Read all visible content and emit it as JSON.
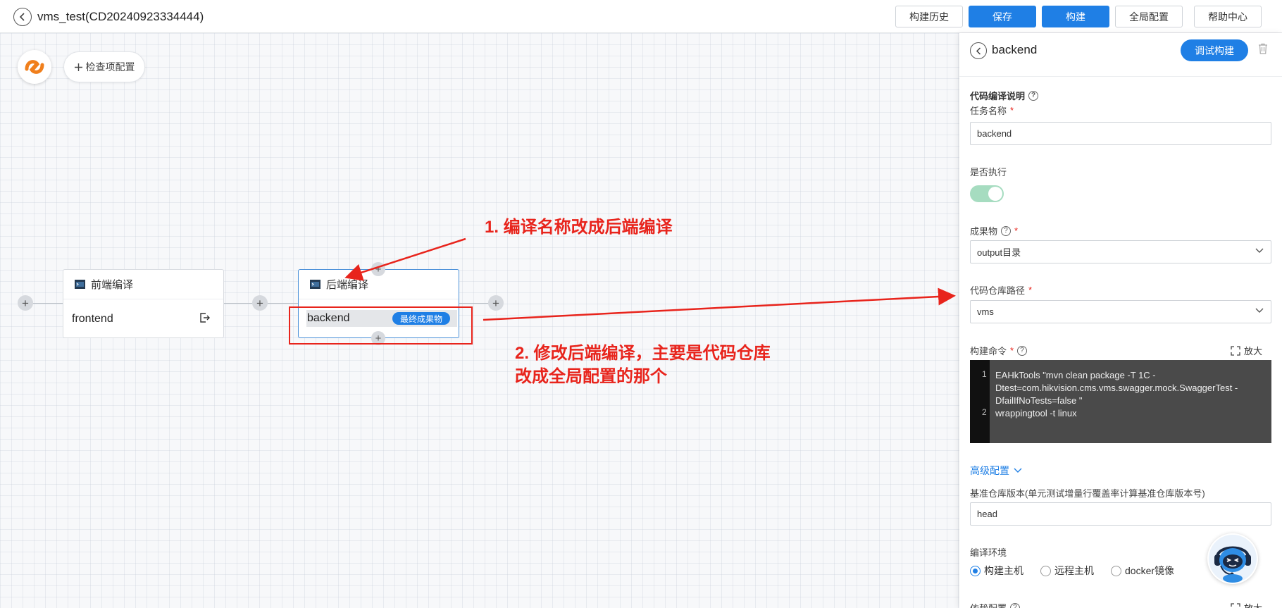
{
  "header": {
    "title": "vms_test(CD20240923334444)",
    "buttons": {
      "history": "构建历史",
      "save": "保存",
      "build": "构建",
      "global_config": "全局配置",
      "help": "帮助中心"
    }
  },
  "canvas": {
    "check_config_label": "检查项配置",
    "plus_symbol": "+",
    "nodes": [
      {
        "title": "前端编译",
        "job": "frontend"
      },
      {
        "title": "后端编译",
        "job": "backend",
        "badge": "最终成果物"
      }
    ],
    "annotations": {
      "step1": "1. 编译名称改成后端编译",
      "step2_line1": "2. 修改后端编译，主要是代码仓库",
      "step2_line2": "改成全局配置的那个"
    },
    "accent_red": "#e8241c"
  },
  "panel": {
    "title": "backend",
    "debug_build": "调试构建",
    "section_title": "代码编译说明",
    "task_name_label": "任务名称",
    "task_name_value": "backend",
    "execute_label": "是否执行",
    "execute_enabled": true,
    "artifact_label": "成果物",
    "artifact_value": "output目录",
    "repo_path_label": "代码仓库路径",
    "repo_path_value": "vms",
    "build_cmd_label": "构建命令",
    "expand_label": "放大",
    "code_lines": [
      {
        "no": "1",
        "text": "EAHkTools \"mvn clean package -T 1C -Dtest=com.hikvision.cms.vms.swagger.mock.SwaggerTest -DfailIfNoTests=false \""
      },
      {
        "no": "2",
        "text": "wrappingtool -t linux"
      }
    ],
    "advanced_label": "高级配置",
    "base_repo_label": "基准仓库版本(单元测试增量行覆盖率计算基准仓库版本号)",
    "base_repo_value": "head",
    "env_label": "编译环境",
    "env_options": [
      "构建主机",
      "远程主机",
      "docker镜像"
    ],
    "env_selected": "构建主机",
    "dependency_label": "依赖配置",
    "required_mark": "*",
    "help_mark": "?"
  },
  "theme": {
    "primary": "#1f7fe5",
    "toggle_on": "#a6dcc0"
  }
}
